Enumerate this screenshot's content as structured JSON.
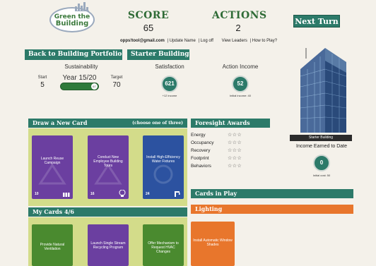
{
  "logo": {
    "line1": "Green the",
    "line2": "Building"
  },
  "header": {
    "score_label": "SCORE",
    "score_value": "65",
    "actions_label": "ACTIONS",
    "actions_value": "2",
    "next_turn": "Next Turn"
  },
  "userbar": {
    "email": "opps!tool@gmail.com",
    "update": "| Update Name",
    "logoff": "| Log off",
    "view_leaders": "View Leaders",
    "how_to": "| How to Play?"
  },
  "nav": {
    "back": "Back to Building Portfolio",
    "starter": "Starter Building"
  },
  "sustainability": {
    "label": "Sustainability",
    "start_label": "Start",
    "start_value": "5",
    "year": "Year 15/20",
    "target_label": "Target",
    "target_value": "70",
    "progress_value": "67",
    "progress_fraction": 0.96
  },
  "satisfaction": {
    "label": "Satisfaction",
    "value": "621",
    "sub": "+12 income"
  },
  "action_income": {
    "label": "Action Income",
    "value": "52",
    "sub": "Initial income: 40"
  },
  "building": {
    "caption": "Starter Building",
    "income_title": "Income Earned to Date",
    "income_value": "0",
    "initial_cost": "Initial cost: 50"
  },
  "draw": {
    "title": "Draw a New Card",
    "choose": "(choose one of three)",
    "cards": [
      {
        "title": "Launch Reuse Campaign",
        "num": "10",
        "color": "purple",
        "icon": "recycle-bins-icon"
      },
      {
        "title": "Conduct New Employee Building Tours",
        "num": "16",
        "color": "purple",
        "icon": "head-icon"
      },
      {
        "title": "Install High-Efficiency Water Fixtures",
        "num": "24",
        "color": "blue",
        "icon": "faucet-icon"
      }
    ]
  },
  "foresight": {
    "title": "Foresight Awards",
    "rows": [
      {
        "label": "Energy",
        "stars": "☆☆☆"
      },
      {
        "label": "Occupancy",
        "stars": "☆☆☆"
      },
      {
        "label": "Recovery",
        "stars": "☆☆☆"
      },
      {
        "label": "Footprint",
        "stars": "☆☆☆"
      },
      {
        "label": "Behaviors",
        "stars": "☆☆☆"
      }
    ]
  },
  "in_play": {
    "title": "Cards in Play",
    "lighting_title": "Lighting"
  },
  "my_cards": {
    "title": "My Cards 4/6",
    "cards": [
      {
        "title": "Provide Natural Ventilation",
        "color": "green"
      },
      {
        "title": "Launch Single Stream Recycling Program",
        "color": "purple"
      },
      {
        "title": "Offer Mechanism to Request HVAC Changes",
        "color": "green"
      }
    ]
  },
  "lighting_card": {
    "title": "Install Automatic Window Shades",
    "color": "orange"
  }
}
